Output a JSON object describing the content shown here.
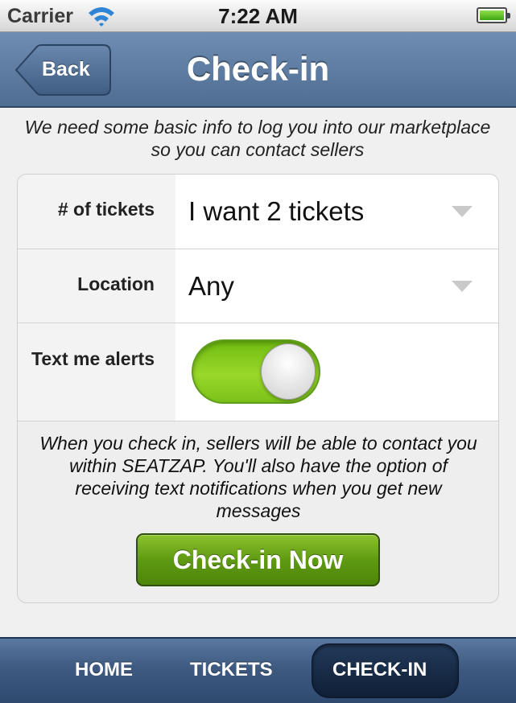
{
  "status_bar": {
    "carrier": "Carrier",
    "time": "7:22 AM",
    "wifi_icon": "wifi-icon",
    "battery_icon": "battery-icon",
    "battery_level": 1.0
  },
  "nav_bar": {
    "back_label": "Back",
    "title": "Check-in"
  },
  "intro_text": "We need some basic info to log you into our marketplace so you can contact sellers",
  "form": {
    "tickets": {
      "label": "# of tickets",
      "value": "I want 2 tickets"
    },
    "location": {
      "label": "Location",
      "value": "Any"
    },
    "alerts": {
      "label": "Text me alerts",
      "enabled": true
    }
  },
  "info_text": "When you check in, sellers will be able to contact you within SEATZAP. You'll also have the option of receiving text notifications when you get new messages",
  "checkin_button_label": "Check-in Now",
  "tab_bar": {
    "tabs": [
      {
        "label": "HOME",
        "active": false
      },
      {
        "label": "TICKETS",
        "active": false
      },
      {
        "label": "CHECK-IN",
        "active": true
      }
    ]
  },
  "colors": {
    "nav_bar": "#5f7da3",
    "toggle_on": "#8fcf22",
    "button_green": "#5f9a12",
    "tab_bar": "#3e5a81"
  }
}
